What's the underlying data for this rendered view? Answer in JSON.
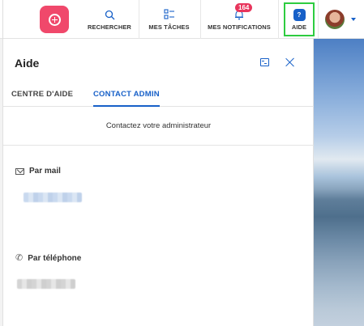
{
  "topbar": {
    "nav": {
      "search_label": "RECHERCHER",
      "tasks_label": "MES TÂCHES",
      "notifications_label": "MES NOTIFICATIONS",
      "notifications_count": "164",
      "help_label": "AIDE"
    },
    "icons": {
      "add": "add-circle-icon",
      "search": "search-icon",
      "tasks": "checklist-icon",
      "notifications": "bell-icon",
      "help": "help-icon",
      "avatar_caret": "chevron-down-icon"
    },
    "colors": {
      "add_button": "#f0486b",
      "accent": "#1760c8",
      "badge": "#e8355c",
      "help_highlight": "#2ecc40"
    }
  },
  "help_panel": {
    "title": "Aide",
    "tabs": [
      {
        "label": "CENTRE D'AIDE",
        "active": false
      },
      {
        "label": "CONTACT ADMIN",
        "active": true
      }
    ],
    "contact_subtitle": "Contactez votre administrateur",
    "mail_heading": "Par mail",
    "phone_heading": "Par téléphone"
  }
}
